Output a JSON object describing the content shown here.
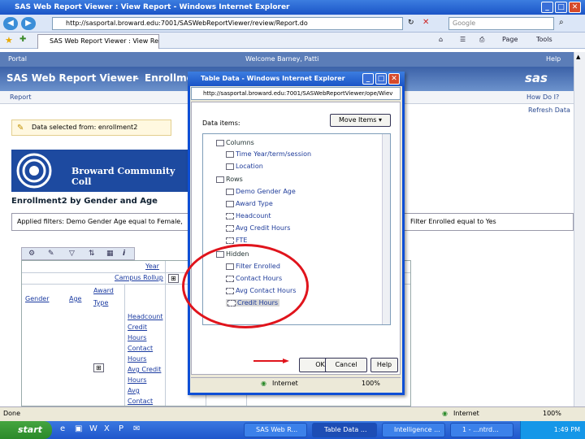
{
  "browser": {
    "title": "SAS Web Report Viewer : View Report - Windows Internet Explorer",
    "address": "http://sasportal.broward.edu:7001/SASWebReportViewer/review/Report.do",
    "search_placeholder": "Google",
    "tab_label": "SAS Web Report Viewer : View Report",
    "toolbar": {
      "page": "Page",
      "tools": "Tools"
    },
    "status_text": "Done",
    "status_zone": "Internet",
    "zoom": "100%"
  },
  "sas": {
    "portal_link": "Portal",
    "welcome": "Welcome Barney, Patti",
    "help": "Help",
    "app_title": "SAS Web Report Viewer",
    "app_title_sep": "-",
    "app_title_rest": "Enrollme",
    "logo": "sas",
    "menu_report": "Report",
    "menu_howdoi": "How Do I?",
    "refresh": "Refresh Data"
  },
  "report": {
    "data_selected_label": "Data selected from:",
    "data_source": "enrollment2",
    "college_name": "Broward Community Coll",
    "title": "Enrollment2 by Gender and Age",
    "applied_filters": "Applied filters:  Demo Gender Age equal to Female,",
    "filter_right": "Filter Enrolled equal to Yes",
    "table": {
      "year": "Year",
      "campus_rollup": "Campus Rollup",
      "gender": "Gender",
      "age": "Age",
      "award": "Award",
      "type": "Type",
      "measures": [
        "Headcount",
        "Credit",
        "Hours",
        "Contact",
        "Hours",
        "Avg Credit",
        "Hours",
        "Avg",
        "Contact"
      ]
    }
  },
  "dialog": {
    "title": "Table Data - Windows Internet Explorer",
    "address": "http://sasportal.broward.edu:7001/SASWebReportViewer/ope/Wiev",
    "data_items_label": "Data items:",
    "move_items": "Move Items",
    "tree": {
      "columns_label": "Columns",
      "columns": [
        "Time Year/term/session",
        "Location"
      ],
      "rows_label": "Rows",
      "rows": [
        "Demo Gender Age",
        "Award Type",
        "Headcount",
        "Avg Credit Hours",
        "FTE"
      ],
      "hidden_label": "Hidden",
      "hidden": [
        "Filter Enrolled",
        "Contact Hours",
        "Avg Contact Hours",
        "Credit Hours"
      ]
    },
    "ok": "OK",
    "cancel": "Cancel",
    "help": "Help",
    "status_zone": "Internet",
    "zoom": "100%"
  },
  "taskbar": {
    "start": "start",
    "tasks": [
      "SAS Web R...",
      "Table Data ...",
      "Intelligence ...",
      "1 - ...ntrd...",
      ""
    ],
    "clock": "1:49 PM"
  },
  "colors": {
    "annotation_red": "#e0141c",
    "ie_blue": "#1b55c7",
    "sas_blue": "#3c62a8"
  }
}
